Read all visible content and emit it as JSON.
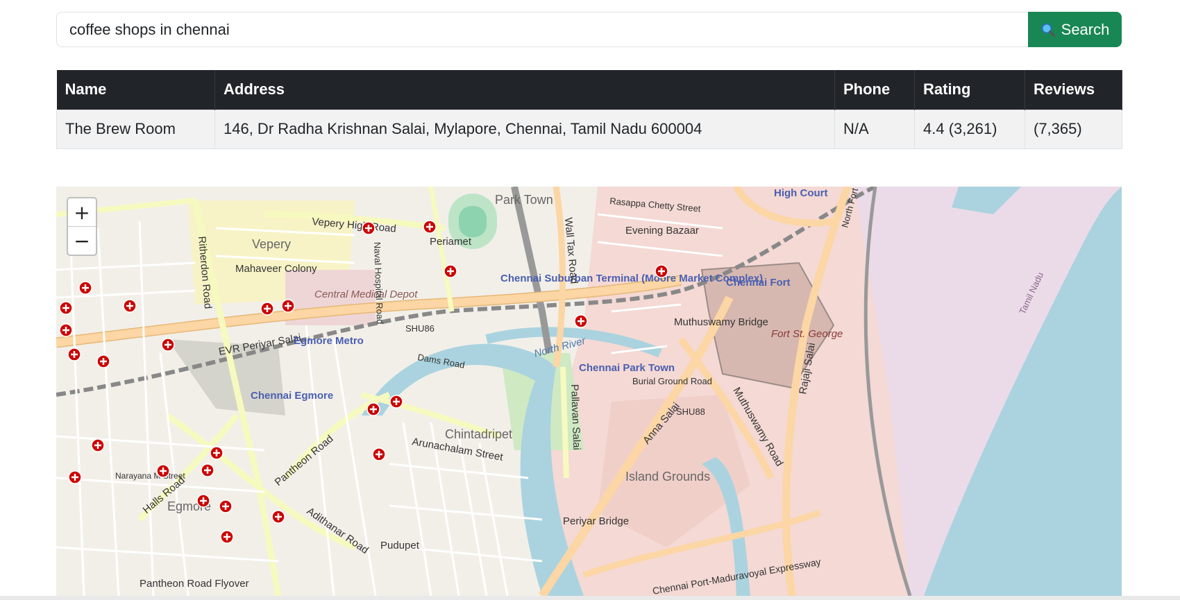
{
  "search": {
    "value": "coffee shops in chennai",
    "button_label": "Search"
  },
  "table": {
    "headers": [
      "Name",
      "Address",
      "Phone",
      "Rating",
      "Reviews"
    ],
    "rows": [
      [
        "The Brew Room",
        "146, Dr Radha Krishnan Salai, Mylapore, Chennai, Tamil Nadu 600004",
        "N/A",
        "4.4 (3,261)",
        "(7,365)"
      ]
    ]
  },
  "map": {
    "zoom_in": "+",
    "zoom_out": "−",
    "labels": [
      "Park Town",
      "Vepery",
      "Vepery High Road",
      "Periamet",
      "Mahaveer Colony",
      "Central Medical Depot",
      "Chennai Suburban Terminal (Moore Market Complex)",
      "Evening Bazaar",
      "High Court",
      "Chennai Fort",
      "Fort St. George",
      "Muthuswamy Bridge",
      "EVR Periyar Salai",
      "Egmore Metro",
      "Chennai Egmore",
      "Chennai Park Town",
      "Burial Ground Road",
      "SHU86",
      "SHU88",
      "Chintadripet",
      "Arunachalam Street",
      "Dams Road",
      "Island Grounds",
      "Egmore",
      "Pudupet",
      "Periyar Bridge",
      "Pantheon Road Flyover",
      "Narayana M Street",
      "Halls Road",
      "Pantheon Road",
      "Adithanar Road",
      "Anna Salai",
      "Rajaji Salai",
      "Muthuswamy Road",
      "Pallavan Salai",
      "Wall Tax Road",
      "North Fort Road",
      "Rasappa Chetty Street",
      "Ritherdon Road",
      "Naval Hospital Road",
      "Chennai Port-Maduravoyal Expressway",
      "North River",
      "Tamil Nadu"
    ],
    "colors": {
      "water": "#aad3df",
      "land": "#f2efe9",
      "primary_road": "#fcd6a4",
      "secondary_road": "#f7fabf",
      "marker": "#cc0000"
    }
  }
}
